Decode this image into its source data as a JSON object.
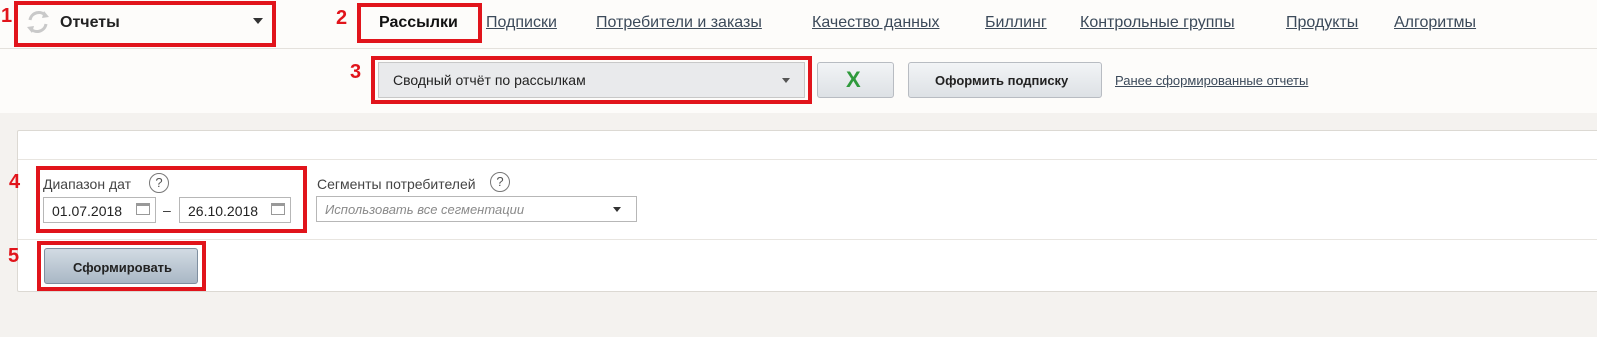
{
  "section_selector": {
    "label": "Отчеты",
    "icon": "refresh-arrows-icon"
  },
  "nav": {
    "active": "Рассылки",
    "links": [
      "Подписки",
      "Потребители и заказы",
      "Качество данных",
      "Биллинг",
      "Контрольные группы",
      "Продукты",
      "Алгоритмы"
    ]
  },
  "report": {
    "selected": "Сводный отчёт по рассылкам",
    "excel_icon": "excel-icon",
    "excel_glyph": "X",
    "subscribe_label": "Оформить подписку",
    "previous_reports_link": "Ранее сформированные отчеты"
  },
  "filters": {
    "date_range_label": "Диапазон дат",
    "date_from": "01.07.2018",
    "date_to": "26.10.2018",
    "dash": "–",
    "segments_label": "Сегменты потребителей",
    "segments_placeholder": "Использовать все сегментации",
    "help_glyph": "?"
  },
  "generate_label": "Сформировать",
  "annotations": [
    "1",
    "2",
    "3",
    "4",
    "5"
  ],
  "colors": {
    "annotation": "#e1141b",
    "excel_green": "#2f9a3c",
    "link": "#3c4a5a"
  }
}
